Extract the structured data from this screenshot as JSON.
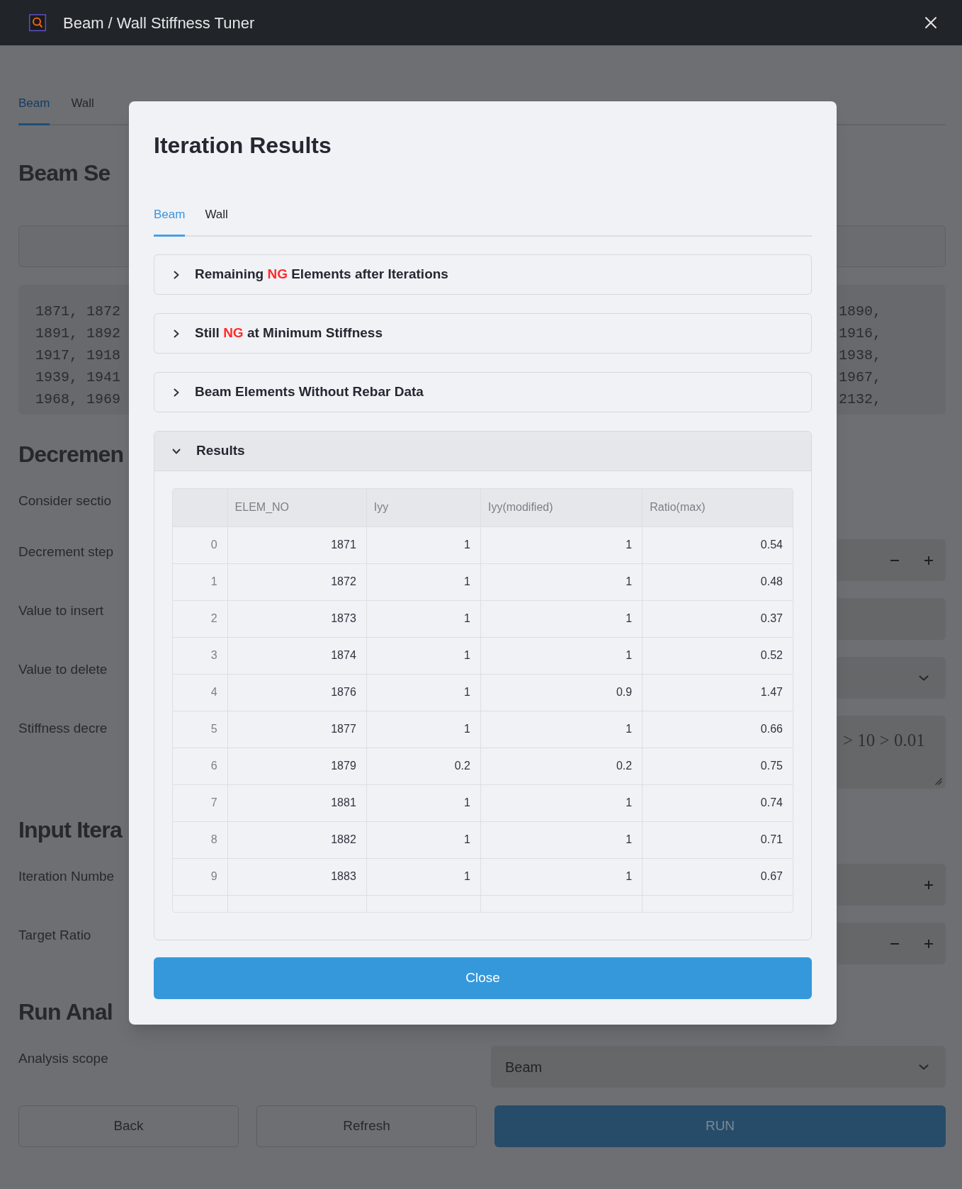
{
  "window": {
    "title": "Beam / Wall Stiffness Tuner"
  },
  "page": {
    "tabs": [
      {
        "label": "Beam",
        "selected": true
      },
      {
        "label": "Wall",
        "selected": false
      }
    ],
    "sections": [
      {
        "title": "Beam Se",
        "items": [
          {
            "kind": "input_box"
          },
          {
            "kind": "code",
            "left_lines": [
              "1871, 1872",
              "1891, 1892",
              "1917, 1918",
              "1939, 1941",
              "1968, 1969"
            ],
            "right_lines": [
              "1890,",
              "1916,",
              "1938,",
              "1967,",
              "2132,"
            ]
          }
        ]
      },
      {
        "title": "Decremen",
        "items": [
          {
            "kind": "label",
            "label": "Consider sectio"
          },
          {
            "kind": "stepper",
            "label": "Decrement step",
            "buttons": [
              {
                "kind": "minus"
              },
              {
                "kind": "plus"
              }
            ]
          },
          {
            "kind": "input",
            "label": "Value to insert"
          },
          {
            "kind": "select",
            "label": "Value to delete"
          },
          {
            "kind": "textarea",
            "label": "Stiffness decre",
            "placeholder": "> 10 > 0.01"
          }
        ]
      },
      {
        "title": "Input Itera",
        "items": [
          {
            "kind": "stepper",
            "label": "Iteration Numbe",
            "buttons": [
              {
                "kind": "plus"
              }
            ]
          },
          {
            "kind": "stepper",
            "label": "Target Ratio",
            "buttons": [
              {
                "kind": "minus"
              },
              {
                "kind": "plus"
              }
            ]
          }
        ]
      },
      {
        "title": "Run Anal",
        "items": [
          {
            "kind": "select",
            "label": "Analysis scope",
            "value": "Beam"
          }
        ]
      }
    ],
    "buttons": [
      {
        "label": "Back",
        "kind": "secondary"
      },
      {
        "label": "Refresh",
        "kind": "secondary"
      },
      {
        "label": "RUN",
        "kind": "primary"
      }
    ]
  },
  "dialog": {
    "title": "Iteration Results",
    "tabs": [
      {
        "label": "Beam",
        "selected": true
      },
      {
        "label": "Wall",
        "selected": false
      }
    ],
    "panels": [
      {
        "title": [
          {
            "text": "Remaining ",
            "highlight": false
          },
          {
            "text": "NG",
            "highlight": true
          },
          {
            "text": " Elements after Iterations",
            "highlight": false
          }
        ],
        "expanded": false
      },
      {
        "title": [
          {
            "text": "Still ",
            "highlight": false
          },
          {
            "text": "NG",
            "highlight": true
          },
          {
            "text": " at Minimum Stiffness",
            "highlight": false
          }
        ],
        "expanded": false
      },
      {
        "title": [
          {
            "text": "Beam Elements Without Rebar Data",
            "highlight": false
          }
        ],
        "expanded": false
      },
      {
        "title": [
          {
            "text": "Results",
            "highlight": false
          }
        ],
        "expanded": true,
        "table": {
          "columns": [
            "ELEM_NO",
            "Iyy",
            "Iyy(modified)",
            "Ratio(max)"
          ],
          "rows": [
            {
              "index": "0",
              "cells": [
                "1871",
                "1",
                "1",
                "0.54"
              ]
            },
            {
              "index": "1",
              "cells": [
                "1872",
                "1",
                "1",
                "0.48"
              ]
            },
            {
              "index": "2",
              "cells": [
                "1873",
                "1",
                "1",
                "0.37"
              ]
            },
            {
              "index": "3",
              "cells": [
                "1874",
                "1",
                "1",
                "0.52"
              ]
            },
            {
              "index": "4",
              "cells": [
                "1876",
                "1",
                "0.9",
                "1.47"
              ]
            },
            {
              "index": "5",
              "cells": [
                "1877",
                "1",
                "1",
                "0.66"
              ]
            },
            {
              "index": "6",
              "cells": [
                "1879",
                "0.2",
                "0.2",
                "0.75"
              ]
            },
            {
              "index": "7",
              "cells": [
                "1881",
                "1",
                "1",
                "0.74"
              ]
            },
            {
              "index": "8",
              "cells": [
                "1882",
                "1",
                "1",
                "0.71"
              ]
            },
            {
              "index": "9",
              "cells": [
                "1883",
                "1",
                "1",
                "0.67"
              ]
            }
          ],
          "truncated": true
        }
      }
    ],
    "close_button": {
      "label": "Close"
    }
  }
}
